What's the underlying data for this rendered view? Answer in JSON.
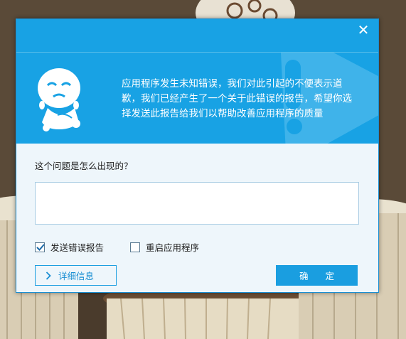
{
  "dialog": {
    "close_glyph": "✕",
    "message": "应用程序发生未知错误，我们对此引起的不便表示道歉，我们已经产生了一个关于此错误的报告，希望你选择发送此报告给我们以帮助改善应用程序的质量",
    "question": "这个问题是怎么出现的？",
    "description_value": "",
    "send_report": {
      "label": "发送错误报告",
      "checked": true
    },
    "restart_app": {
      "label": "重启应用程序",
      "checked": false
    },
    "details_button": "详细信息",
    "ok_button": "确 定",
    "mascot_icon": "crying-mascot-icon",
    "accent_color": "#18a2e4"
  }
}
